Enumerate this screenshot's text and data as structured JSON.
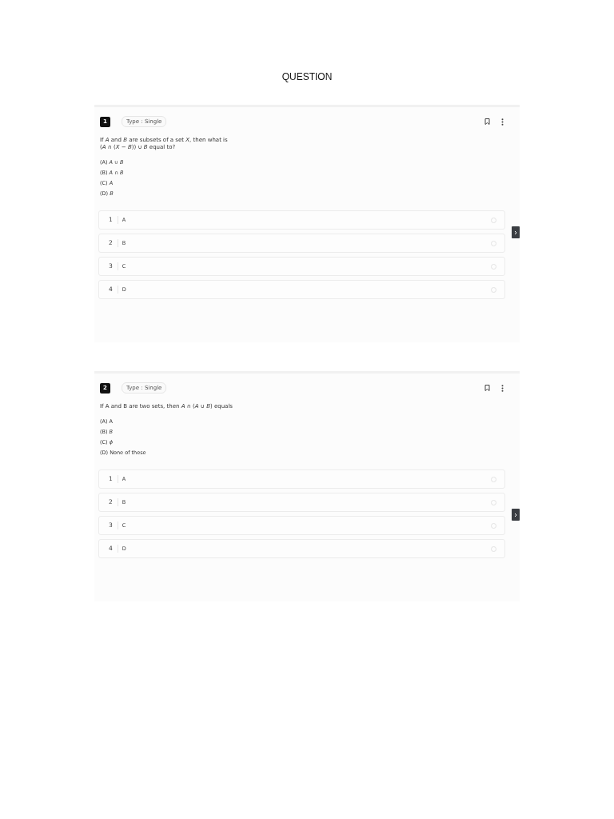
{
  "heading": "QUESTION",
  "questions": [
    {
      "number": "1",
      "type": "Type : Single",
      "text": "If *A* and *B* are subsets of a set *X*, then what is",
      "text_2": "(*A* ∩ (*X* − *B*)) ∪ *B* equal to?",
      "choices": [
        "(A) *A* ∪ *B*",
        "(B) *A* ∩ *B*",
        "(C) *A*",
        "(D) *B*"
      ],
      "options": [
        {
          "index": "1",
          "label": "A",
          "selected": false
        },
        {
          "index": "2",
          "label": "B",
          "selected": false
        },
        {
          "index": "3",
          "label": "C",
          "selected": false
        },
        {
          "index": "4",
          "label": "D",
          "selected": false
        }
      ]
    },
    {
      "number": "2",
      "type": "Type : Single",
      "text": "If A and B are two sets, then *A* ∩ (*A* ∪ *B*) equals",
      "choices": [
        "(A) A",
        "(B) *B*",
        "(C) *ϕ*",
        "(D) None of these"
      ],
      "options": [
        {
          "index": "1",
          "label": "A",
          "selected": false
        },
        {
          "index": "2",
          "label": "B",
          "selected": false
        },
        {
          "index": "3",
          "label": "C",
          "selected": false
        },
        {
          "index": "4",
          "label": "D",
          "selected": false
        }
      ]
    }
  ]
}
